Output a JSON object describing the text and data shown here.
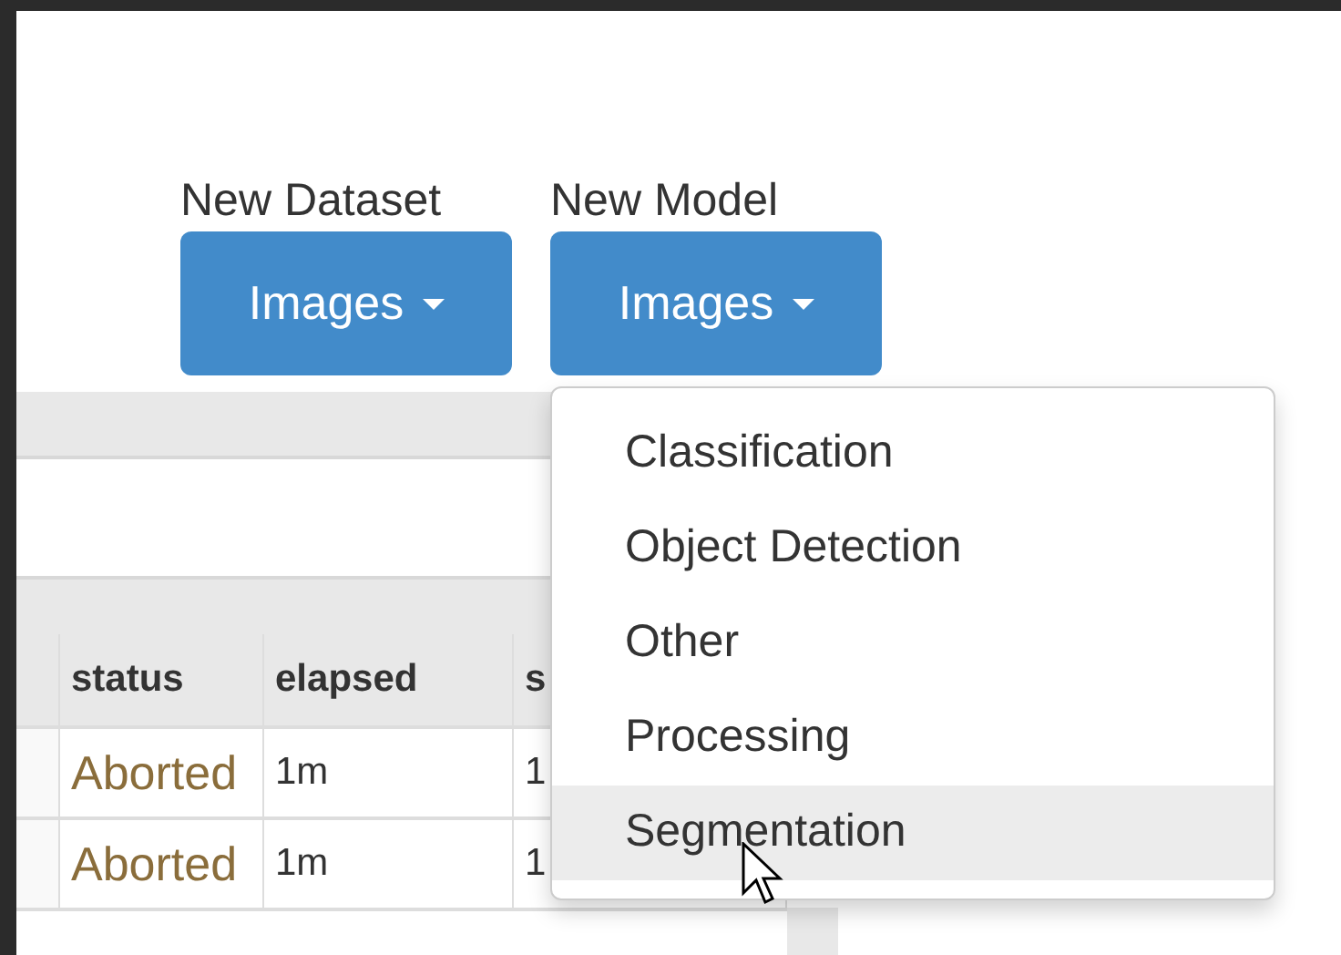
{
  "buttons": [
    {
      "label": "New Dataset",
      "button": "Images"
    },
    {
      "label": "New Model",
      "button": "Images",
      "menu": [
        {
          "label": "Classification",
          "selected": false
        },
        {
          "label": "Object Detection",
          "selected": false
        },
        {
          "label": "Other",
          "selected": false
        },
        {
          "label": "Processing",
          "selected": false
        },
        {
          "label": "Segmentation",
          "selected": true
        }
      ]
    }
  ],
  "table": {
    "columns": [
      "status",
      "elapsed",
      "s"
    ],
    "rows": [
      [
        "Aborted",
        "1m",
        "1"
      ],
      [
        "Aborted",
        "1m",
        "1"
      ]
    ]
  }
}
